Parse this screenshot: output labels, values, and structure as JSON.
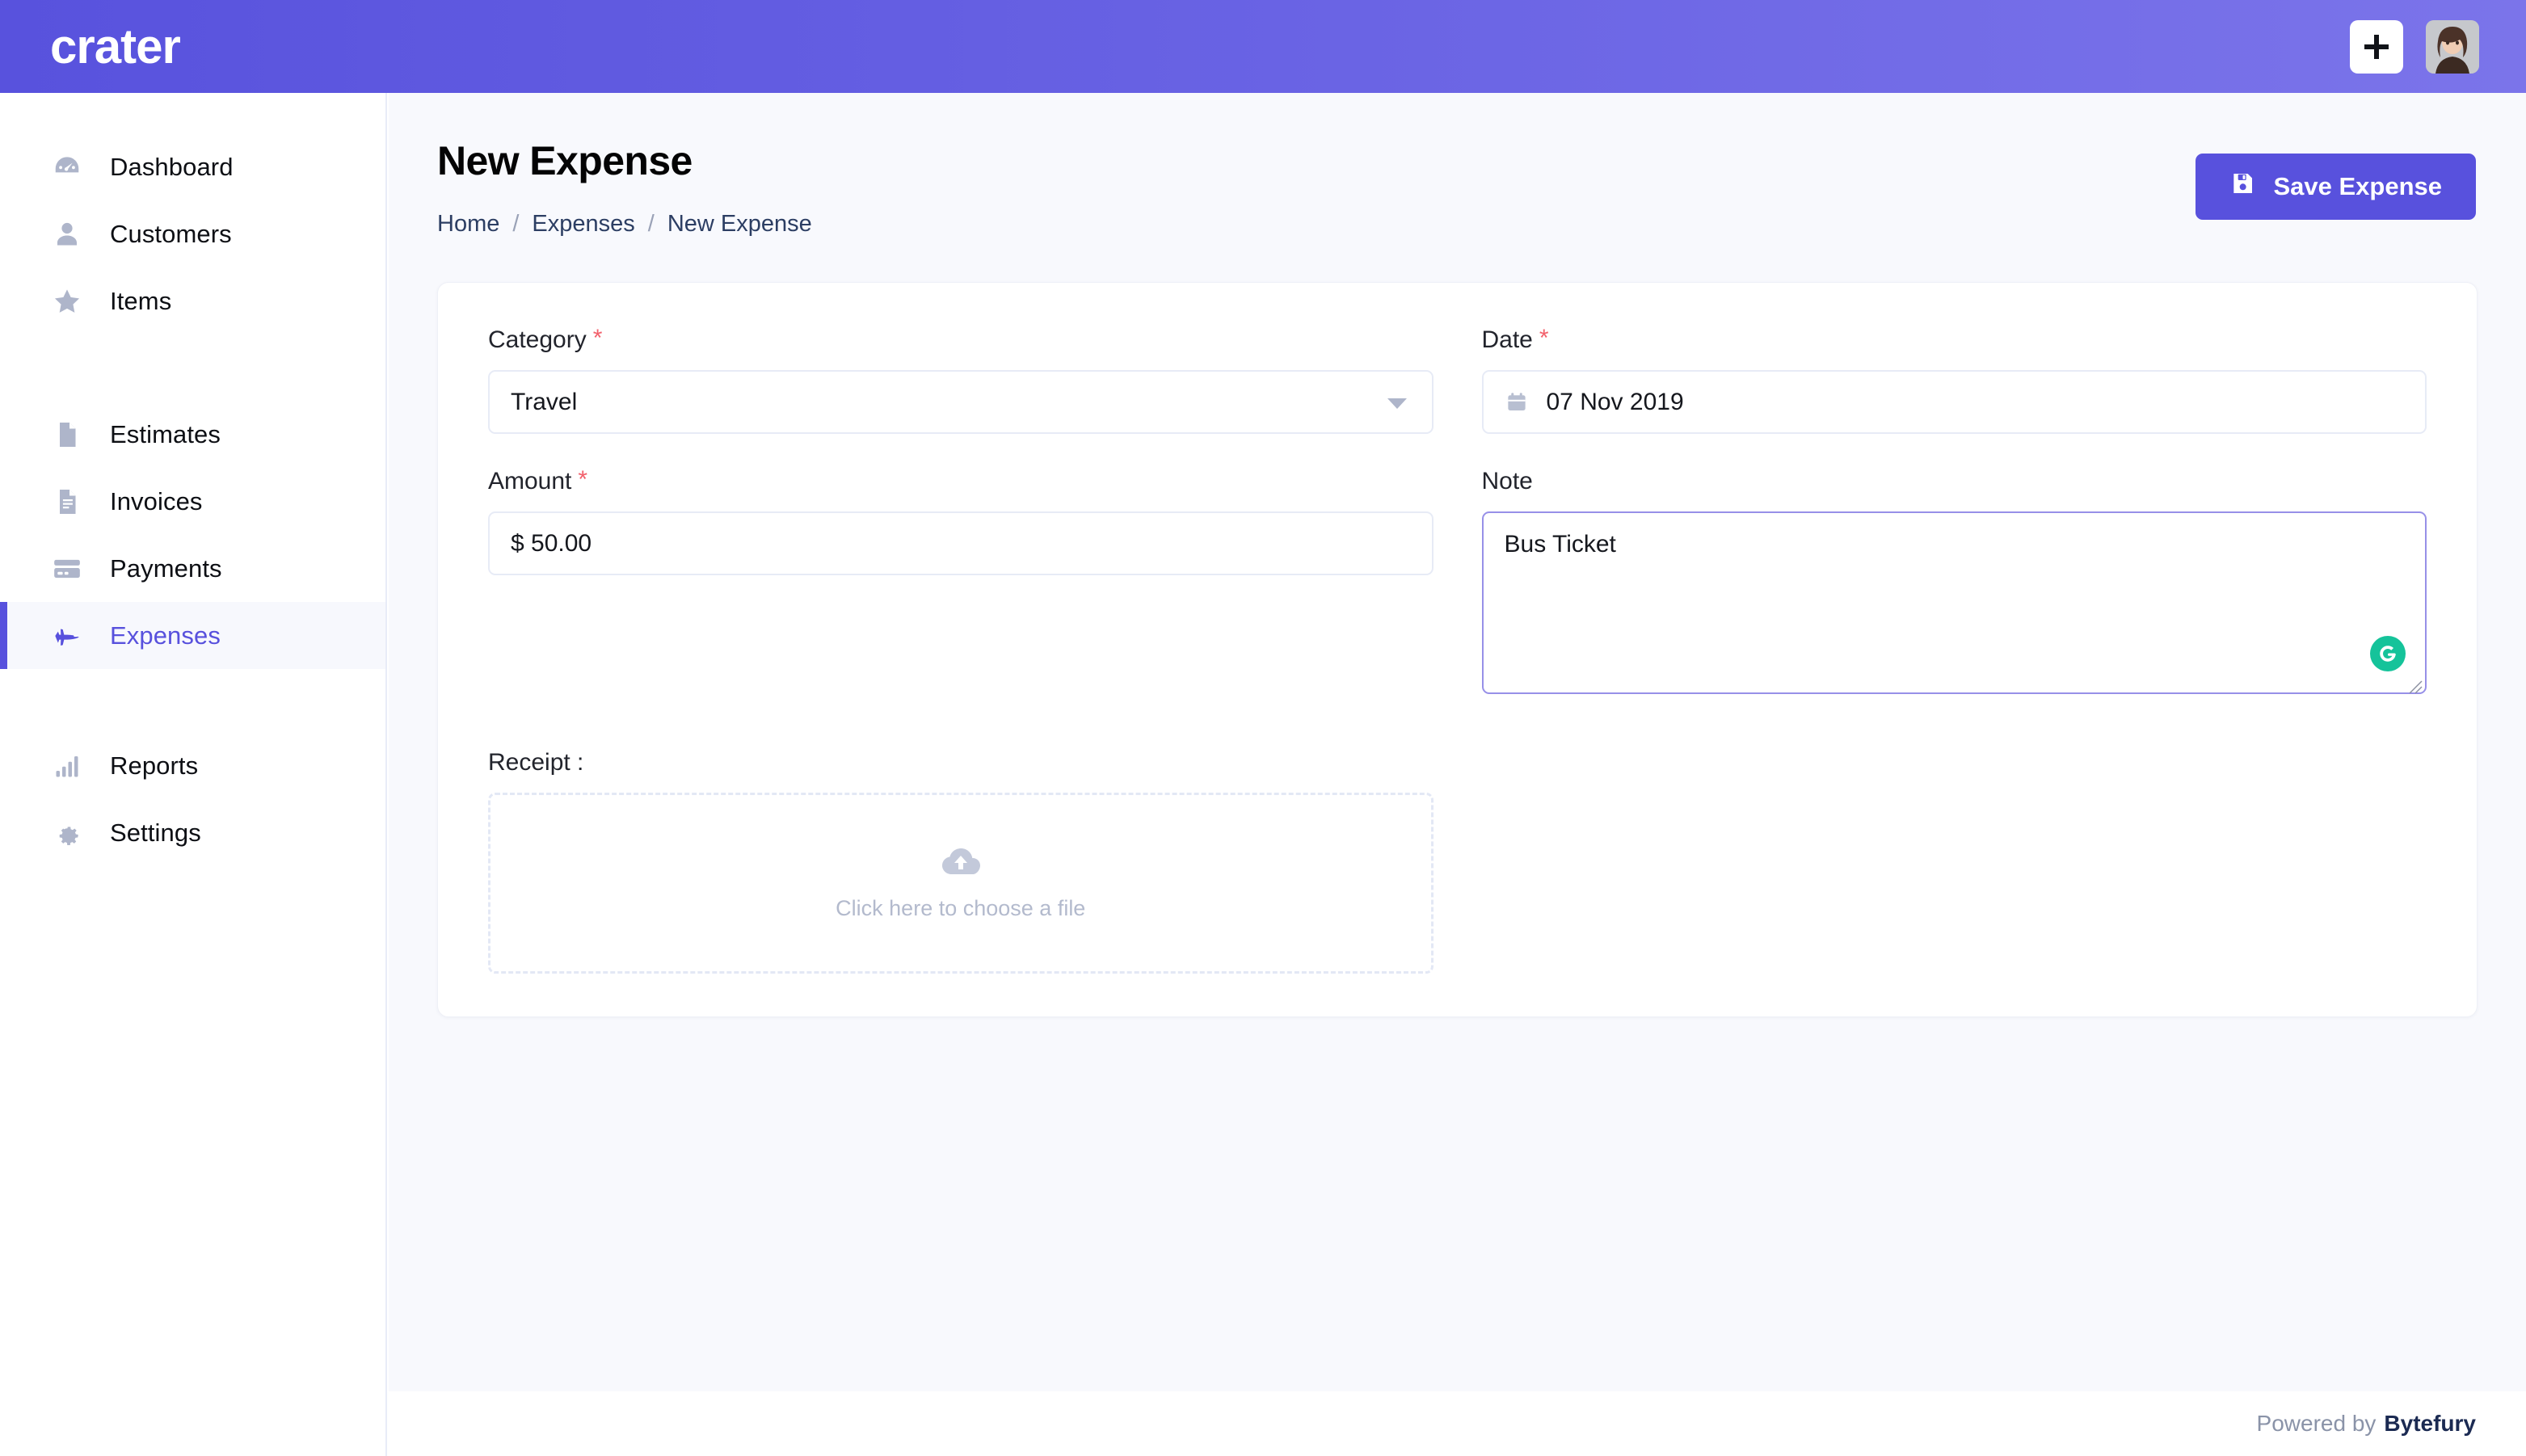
{
  "brand": {
    "logo_text": "crater",
    "accent_color": "#5851dd",
    "header_gradient_from": "#5852dd",
    "header_gradient_to": "#7b74ea"
  },
  "topbar": {
    "add_button_label": "+",
    "add_icon": "plus-icon",
    "avatar_icon": "user-avatar"
  },
  "sidebar": {
    "items": [
      {
        "label": "Dashboard",
        "icon": "dashboard-gauge-icon",
        "active": false
      },
      {
        "label": "Customers",
        "icon": "person-icon",
        "active": false
      },
      {
        "label": "Items",
        "icon": "star-icon",
        "active": false
      },
      {
        "label": "Estimates",
        "icon": "document-icon",
        "active": false
      },
      {
        "label": "Invoices",
        "icon": "document-lines-icon",
        "active": false
      },
      {
        "label": "Payments",
        "icon": "credit-card-icon",
        "active": false
      },
      {
        "label": "Expenses",
        "icon": "rocket-icon",
        "active": true
      },
      {
        "label": "Reports",
        "icon": "bar-chart-icon",
        "active": false
      },
      {
        "label": "Settings",
        "icon": "gear-icon",
        "active": false
      }
    ]
  },
  "page": {
    "title": "New Expense",
    "breadcrumb": [
      {
        "label": "Home"
      },
      {
        "label": "Expenses"
      },
      {
        "label": "New Expense"
      }
    ],
    "breadcrumb_separator": "/",
    "save_button_label": "Save Expense",
    "save_button_icon": "save-disk-icon"
  },
  "form": {
    "category": {
      "label": "Category",
      "required_marker": "*",
      "value": "Travel",
      "icon": "chevron-down-icon"
    },
    "date": {
      "label": "Date",
      "required_marker": "*",
      "value": "07 Nov 2019",
      "icon": "calendar-icon"
    },
    "amount": {
      "label": "Amount",
      "required_marker": "*",
      "value": "$ 50.00"
    },
    "note": {
      "label": "Note",
      "value": "Bus Ticket",
      "badge_icon": "grammarly-icon",
      "badge_letter": "G",
      "badge_color": "#15c39a",
      "focused_border_color": "#9790e8"
    },
    "receipt": {
      "label": "Receipt :",
      "dropzone_text": "Click here to choose a file",
      "dropzone_icon": "cloud-upload-icon"
    }
  },
  "footer": {
    "powered_text": "Powered by",
    "brand": "Bytefury"
  }
}
